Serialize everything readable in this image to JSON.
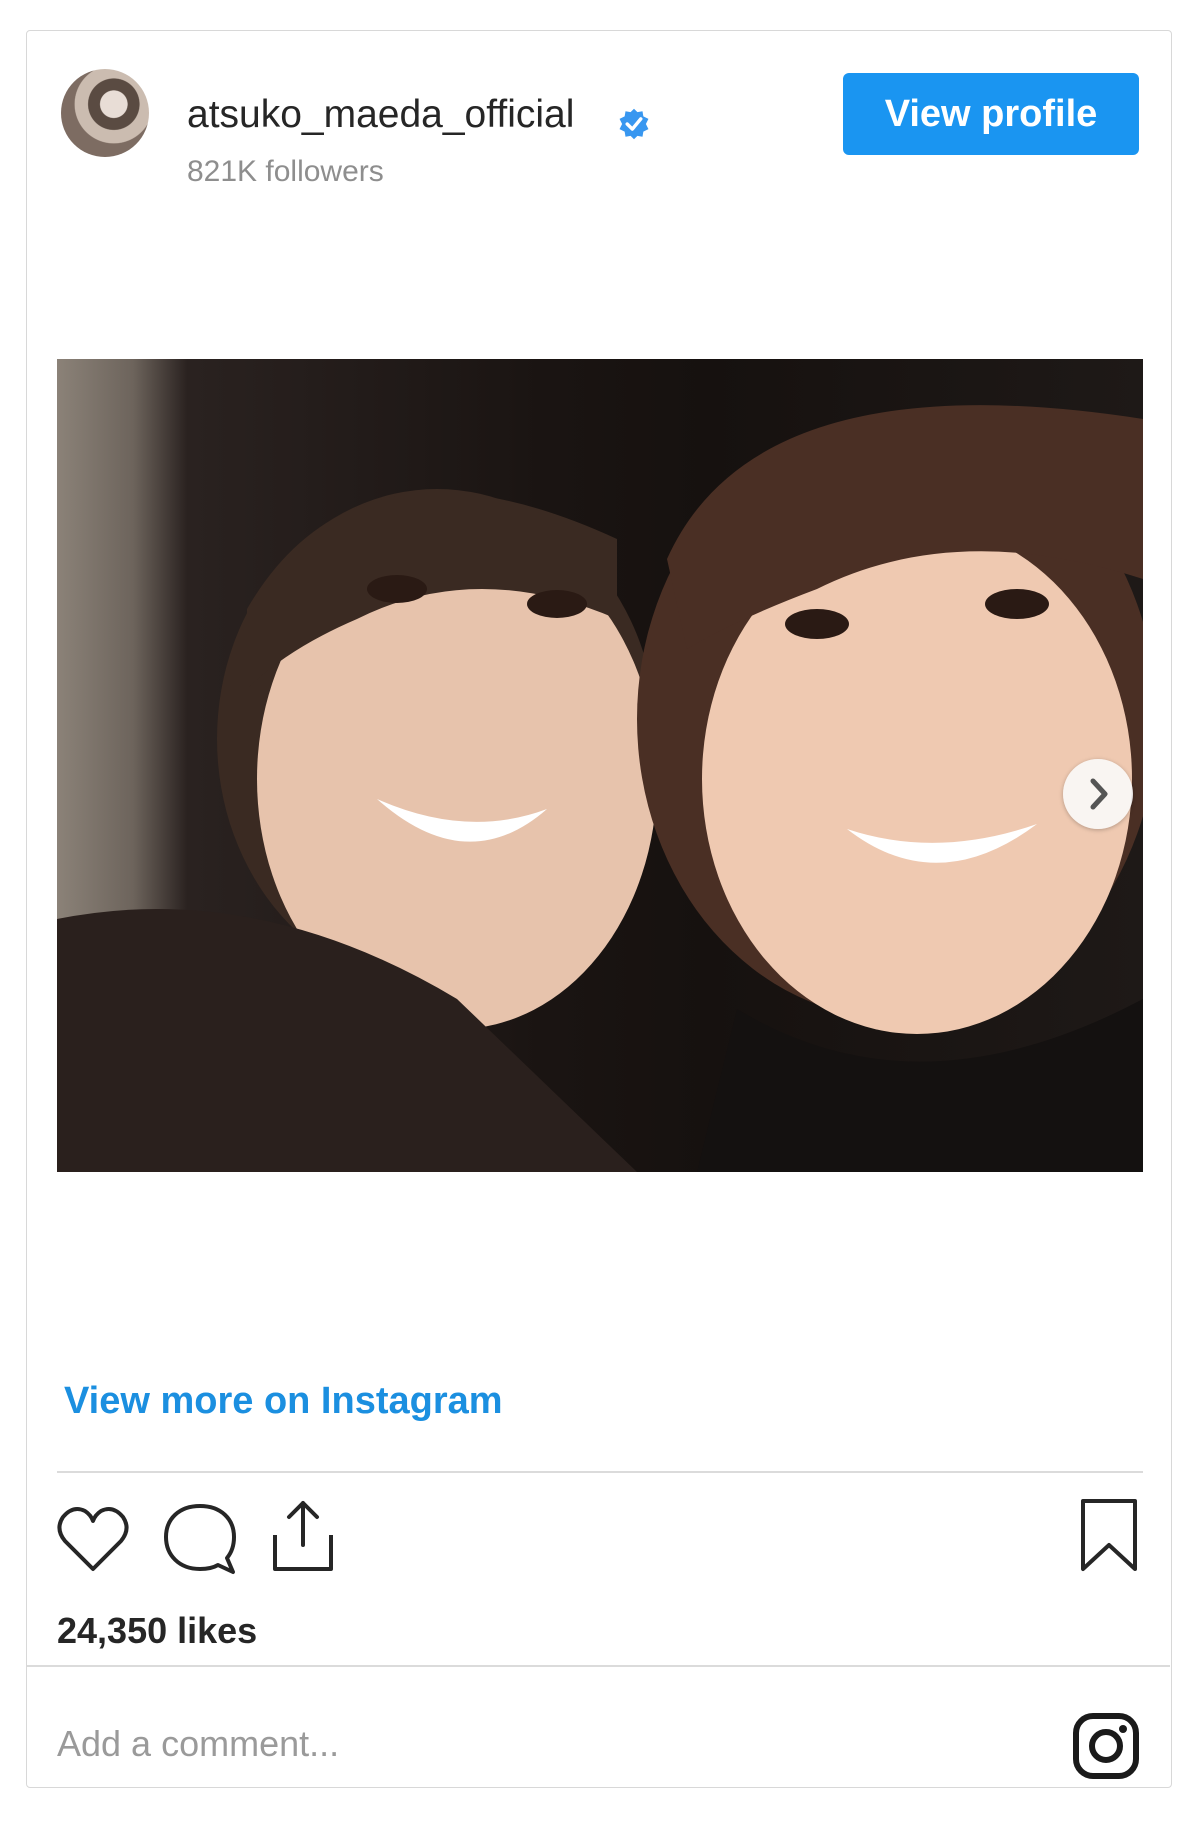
{
  "post": {
    "username": "atsuko_maeda_official",
    "followers": "821K followers",
    "view_profile_label": "View profile",
    "view_more_label": "View more on Instagram",
    "likes": "24,350 likes",
    "comment_placeholder": "Add a comment..."
  },
  "colors": {
    "accent": "#1a95f1",
    "link": "#1b8fe0",
    "text": "#262626",
    "muted": "#8e8e8e"
  },
  "icons": {
    "verified": "verified-badge-icon",
    "next": "chevron-right-icon",
    "like": "heart-icon",
    "comment": "comment-bubble-icon",
    "share": "share-icon",
    "save": "bookmark-icon",
    "brand": "instagram-logo-icon"
  }
}
